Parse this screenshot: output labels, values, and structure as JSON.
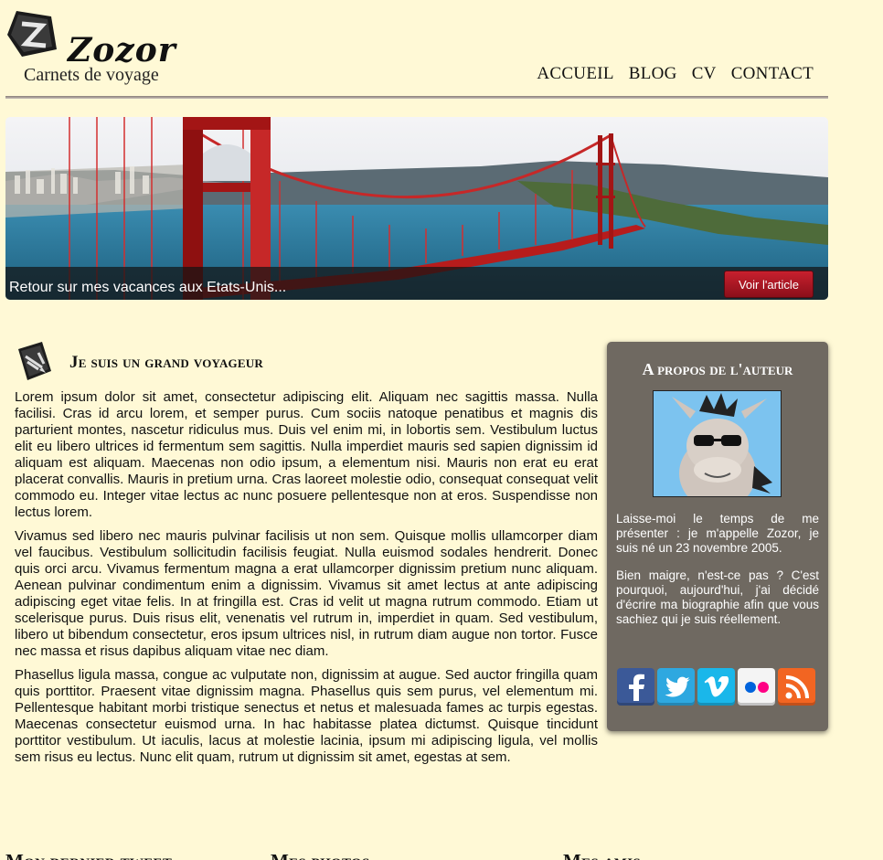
{
  "header": {
    "brand": "Zozor",
    "tagline": "Carnets de voyage",
    "nav": [
      "ACCUEIL",
      "BLOG",
      "CV",
      "CONTACT"
    ]
  },
  "banner": {
    "caption": "Retour sur mes vacances aux Etats-Unis...",
    "button_label": "Voir l'article"
  },
  "article": {
    "title": "Je suis un grand voyageur",
    "paragraphs": [
      "Lorem ipsum dolor sit amet, consectetur adipiscing elit. Aliquam nec sagittis massa. Nulla facilisi. Cras id arcu lorem, et semper purus. Cum sociis natoque penatibus et magnis dis parturient montes, nascetur ridiculus mus. Duis vel enim mi, in lobortis sem. Vestibulum luctus elit eu libero ultrices id fermentum sem sagittis. Nulla imperdiet mauris sed sapien dignissim id aliquam est aliquam. Maecenas non odio ipsum, a elementum nisi. Mauris non erat eu erat placerat convallis. Mauris in pretium urna. Cras laoreet molestie odio, consequat consequat velit commodo eu. Integer vitae lectus ac nunc posuere pellentesque non at eros. Suspendisse non lectus lorem.",
      "Vivamus sed libero nec mauris pulvinar facilisis ut non sem. Quisque mollis ullamcorper diam vel faucibus. Vestibulum sollicitudin facilisis feugiat. Nulla euismod sodales hendrerit. Donec quis orci arcu. Vivamus fermentum magna a erat ullamcorper dignissim pretium nunc aliquam. Aenean pulvinar condimentum enim a dignissim. Vivamus sit amet lectus at ante adipiscing adipiscing eget vitae felis. In at fringilla est. Cras id velit ut magna rutrum commodo. Etiam ut scelerisque purus. Duis risus elit, venenatis vel rutrum in, imperdiet in quam. Sed vestibulum, libero ut bibendum consectetur, eros ipsum ultrices nisl, in rutrum diam augue non tortor. Fusce nec massa et risus dapibus aliquam vitae nec diam.",
      "Phasellus ligula massa, congue ac vulputate non, dignissim at augue. Sed auctor fringilla quam quis porttitor. Praesent vitae dignissim magna. Phasellus quis sem purus, vel elementum mi. Pellentesque habitant morbi tristique senectus et netus et malesuada fames ac turpis egestas. Maecenas consectetur euismod urna. In hac habitasse platea dictumst. Quisque tincidunt porttitor vestibulum. Ut iaculis, lacus at molestie lacinia, ipsum mi adipiscing ligula, vel mollis sem risus eu lectus. Nunc elit quam, rutrum ut dignissim sit amet, egestas at sem."
    ]
  },
  "aside": {
    "title": "A propos de l'auteur",
    "paragraphs": [
      "Laisse-moi le temps de me présenter : je m'appelle Zozor, je suis né un 23 novembre 2005.",
      "Bien maigre, n'est-ce pas ? C'est pourquoi, aujourd'hui, j'ai décidé d'écrire ma biographie afin que vous sachiez qui je suis réellement."
    ],
    "socials": [
      {
        "name": "facebook-icon",
        "color": "#3b5998"
      },
      {
        "name": "twitter-icon",
        "color": "#2ea8e0"
      },
      {
        "name": "vimeo-icon",
        "color": "#1ab7ea"
      },
      {
        "name": "flickr-icon",
        "color": "#f4f4f4"
      },
      {
        "name": "rss-icon",
        "color": "#f26522"
      }
    ]
  },
  "footer_sections": [
    "Mon dernier tweet",
    "Mes photos",
    "Mes amis"
  ],
  "colors": {
    "background": "#fff9d6",
    "aside": "#6f6961",
    "button": "#b01825"
  }
}
